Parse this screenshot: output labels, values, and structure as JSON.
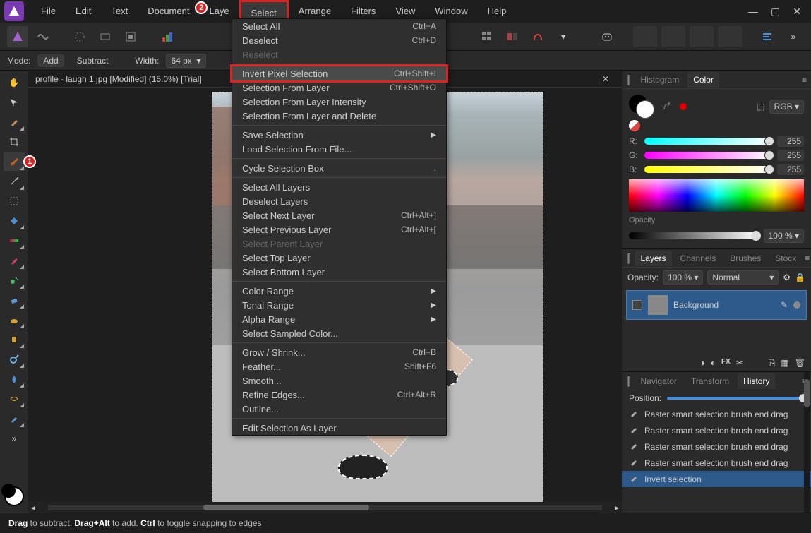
{
  "menubar": {
    "items": [
      "File",
      "Edit",
      "Text",
      "Document",
      "Layer",
      "Select",
      "Arrange",
      "Filters",
      "View",
      "Window",
      "Help"
    ],
    "highlighted_index": 5,
    "badge2_index": 4
  },
  "optionsbar": {
    "mode_label": "Mode:",
    "add_label": "Add",
    "subtract_label": "Subtract",
    "width_label": "Width:",
    "width_value": "64 px"
  },
  "document": {
    "tab_title": "profile - laugh 1.jpg [Modified] (15.0%) [Trial]"
  },
  "select_menu": [
    {
      "label": "Select All",
      "shortcut": "Ctrl+A"
    },
    {
      "label": "Deselect",
      "shortcut": "Ctrl+D"
    },
    {
      "label": "Reselect",
      "disabled": true
    },
    {
      "sep": true
    },
    {
      "label": "Invert Pixel Selection",
      "shortcut": "Ctrl+Shift+I",
      "highlight": true
    },
    {
      "label": "Selection From Layer",
      "shortcut": "Ctrl+Shift+O"
    },
    {
      "label": "Selection From Layer Intensity"
    },
    {
      "label": "Selection From Layer and Delete"
    },
    {
      "sep": true
    },
    {
      "label": "Save Selection",
      "submenu": true
    },
    {
      "label": "Load Selection From File..."
    },
    {
      "sep": true
    },
    {
      "label": "Cycle Selection Box",
      "shortcut": "."
    },
    {
      "sep": true
    },
    {
      "label": "Select All Layers"
    },
    {
      "label": "Deselect Layers"
    },
    {
      "label": "Select Next Layer",
      "shortcut": "Ctrl+Alt+]"
    },
    {
      "label": "Select Previous Layer",
      "shortcut": "Ctrl+Alt+["
    },
    {
      "label": "Select Parent Layer",
      "disabled": true
    },
    {
      "label": "Select Top Layer"
    },
    {
      "label": "Select Bottom Layer"
    },
    {
      "sep": true
    },
    {
      "label": "Color Range",
      "submenu": true
    },
    {
      "label": "Tonal Range",
      "submenu": true
    },
    {
      "label": "Alpha Range",
      "submenu": true
    },
    {
      "label": "Select Sampled Color..."
    },
    {
      "sep": true
    },
    {
      "label": "Grow / Shrink...",
      "shortcut": "Ctrl+B"
    },
    {
      "label": "Feather...",
      "shortcut": "Shift+F6"
    },
    {
      "label": "Smooth..."
    },
    {
      "label": "Refine Edges...",
      "shortcut": "Ctrl+Alt+R"
    },
    {
      "label": "Outline..."
    },
    {
      "sep": true
    },
    {
      "label": "Edit Selection As Layer"
    }
  ],
  "panels": {
    "top_tabs": [
      "Histogram",
      "Color"
    ],
    "top_active": 1,
    "color": {
      "mode": "RGB",
      "r_label": "R:",
      "g_label": "G:",
      "b_label": "B:",
      "r": 255,
      "g": 255,
      "b": 255,
      "opacity_label": "Opacity",
      "opacity_value": "100 %"
    },
    "mid_tabs": [
      "Layers",
      "Channels",
      "Brushes",
      "Stock"
    ],
    "mid_active": 0,
    "layers": {
      "opacity_label": "Opacity:",
      "opacity_value": "100 %",
      "blend_mode": "Normal",
      "items": [
        {
          "name": "Background"
        }
      ]
    },
    "bottom_tabs": [
      "Navigator",
      "Transform",
      "History"
    ],
    "bottom_active": 2,
    "history": {
      "position_label": "Position:",
      "items": [
        "Raster smart selection brush end drag",
        "Raster smart selection brush end drag",
        "Raster smart selection brush end drag",
        "Raster smart selection brush end drag",
        "Invert selection"
      ],
      "selected_index": 4
    }
  },
  "statusbar": {
    "html": "<b>Drag</b> to subtract. <b>Drag+Alt</b> to add. <b>Ctrl</b> to toggle snapping to edges"
  },
  "tools_badge1_index": 4
}
